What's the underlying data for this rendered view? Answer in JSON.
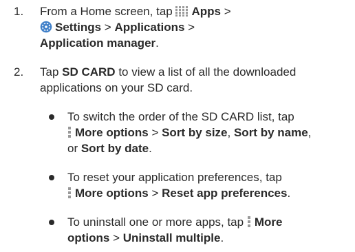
{
  "steps": [
    {
      "number": "1.",
      "lines": [
        {
          "a": "From a Home screen, tap ",
          "b": "Apps",
          "c": " >"
        },
        {
          "b": "Settings",
          "c": " > ",
          "d": "Applications",
          "e": " >"
        },
        {
          "b": "Application manager",
          "c": "."
        }
      ]
    },
    {
      "number": "2.",
      "lines": [
        {
          "a": "Tap ",
          "b": "SD CARD",
          "c": " to view a list of all the downloaded"
        },
        {
          "a": "applications on your SD card."
        }
      ]
    }
  ],
  "bullets": [
    {
      "lines": [
        {
          "a": "To switch the order of the SD CARD list, tap"
        },
        {
          "b": "More options",
          "c": " > ",
          "d": "Sort by size",
          "e": ", ",
          "f": "Sort by name",
          "g": ","
        },
        {
          "a": "or ",
          "b": "Sort by date",
          "c": "."
        }
      ]
    },
    {
      "lines": [
        {
          "a": "To reset your application preferences, tap"
        },
        {
          "b": "More options",
          "c": " > ",
          "d": "Reset app preferences",
          "e": "."
        }
      ]
    },
    {
      "lines": [
        {
          "a": "To uninstall one or more apps, tap ",
          "b": "More"
        },
        {
          "b": "options",
          "c": " > ",
          "d": "Uninstall multiple",
          "e": "."
        }
      ]
    }
  ],
  "icons": {
    "apps": "apps-grid-icon",
    "settings": "settings-gear-icon",
    "more": "more-options-icon"
  },
  "colors": {
    "text": "#2a2a2a",
    "settings_icon_blue": "#3f7fc8",
    "icon_gray": "#9a9a9a"
  }
}
